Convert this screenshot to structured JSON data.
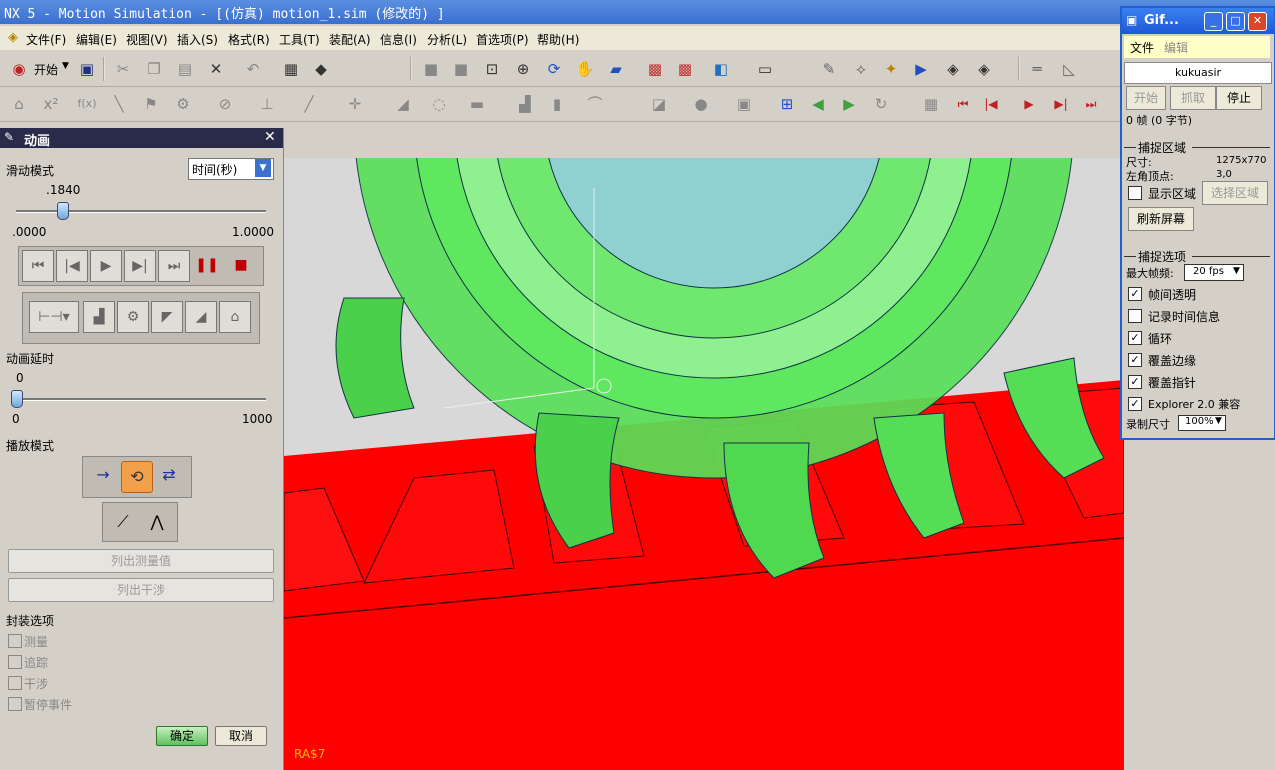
{
  "window": {
    "title": "NX 5 - Motion Simulation - [(仿真) motion_1.sim  (修改的) ]"
  },
  "menubar": [
    "文件(F)",
    "编辑(E)",
    "视图(V)",
    "插入(S)",
    "格式(R)",
    "工具(T)",
    "装配(A)",
    "信息(I)",
    "分析(L)",
    "首选项(P)",
    "帮助(H)"
  ],
  "toolbar": {
    "start_label": "开始"
  },
  "panel": {
    "title": "动画",
    "slide_mode_label": "滑动模式",
    "slide_mode_value": "时间(秒)",
    "time": {
      "current": ".1840",
      "min": ".0000",
      "max": "1.0000",
      "fraction": 0.184
    },
    "delay_label": "动画延时",
    "delay": {
      "current": "0",
      "min": "0",
      "max": "1000",
      "fraction": 0
    },
    "play_mode_label": "播放模式",
    "list_measure_label": "列出测量值",
    "list_interference_label": "列出干涉",
    "package_options_label": "封装选项",
    "package_options": [
      "测量",
      "追踪",
      "干涉",
      "暂停事件"
    ],
    "ok_label": "确定",
    "cancel_label": "取消"
  },
  "viewport": {
    "status_text": "RA$7"
  },
  "gif": {
    "title": "Gif...",
    "menu": [
      "文件",
      "编辑"
    ],
    "user": "kukuasir",
    "buttons": {
      "start": "开始",
      "capture": "抓取",
      "stop": "停止"
    },
    "frames": "0 帧 (0 字节)",
    "capture_region_label": "捕捉区域",
    "size_label": "尺寸:",
    "size_value": "1275x770",
    "corner_label": "左角顶点:",
    "corner_value": "3,0",
    "show_region_label": "显示区域",
    "select_region_label": "选择区域",
    "refresh_label": "刷新屏幕",
    "capture_options_label": "捕捉选项",
    "max_fps_label": "最大帧频:",
    "max_fps_value": "20 fps",
    "options": [
      {
        "label": "帧间透明",
        "checked": true
      },
      {
        "label": "记录时间信息",
        "checked": false
      },
      {
        "label": "循环",
        "checked": true
      },
      {
        "label": "覆盖边缘",
        "checked": true
      },
      {
        "label": "覆盖指针",
        "checked": true
      },
      {
        "label": "Explorer 2.0 兼容",
        "checked": true
      }
    ],
    "record_size_label": "录制尺寸",
    "record_size_value": "100%"
  },
  "colors": {
    "rack": "#ff0000",
    "gear": "#55e055",
    "titlebar": "#3a6fd0"
  }
}
